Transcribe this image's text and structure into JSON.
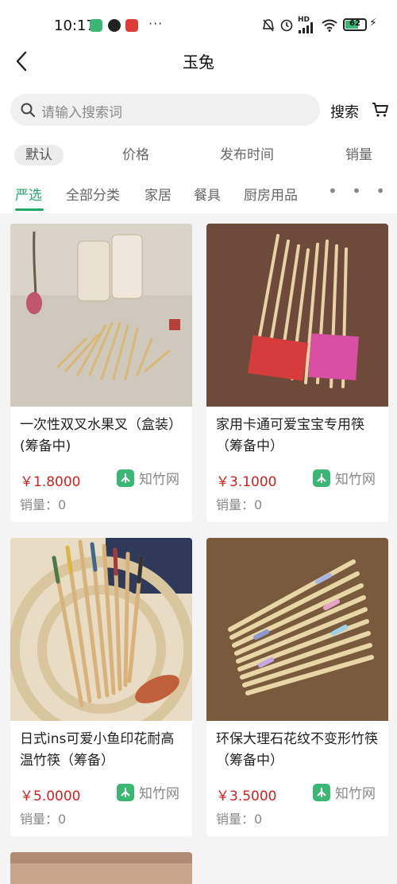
{
  "status_bar": {
    "time": "10:17",
    "battery": "62"
  },
  "header": {
    "title": "玉兔"
  },
  "search": {
    "placeholder": "请输入搜索词",
    "button_label": "搜索"
  },
  "sort_options": [
    "默认",
    "价格",
    "发布时间",
    "销量"
  ],
  "categories": [
    "严选",
    "全部分类",
    "家居",
    "餐具",
    "厨房用品"
  ],
  "more_label": "• • •",
  "products": [
    {
      "name": "一次性双叉水果叉（盒装）(筹备中)",
      "price": "￥1.8000",
      "brand": "知竹网",
      "sales": "销量：0",
      "image": "bamboo-fruit-forks"
    },
    {
      "name": "家用卡通可爱宝宝专用筷（筹备中）",
      "price": "￥3.1000",
      "brand": "知竹网",
      "sales": "销量：0",
      "image": "cartoon-chopsticks"
    },
    {
      "name": "日式ins可爱小鱼印花耐高温竹筷（筹备）",
      "price": "￥5.0000",
      "brand": "知竹网",
      "sales": "销量：0",
      "image": "fish-print-chopsticks"
    },
    {
      "name": "环保大理石花纹不变形竹筷（筹备中）",
      "price": "￥3.5000",
      "brand": "知竹网",
      "sales": "销量：0",
      "image": "marble-chopsticks"
    }
  ],
  "colors": {
    "accent": "#27a86a",
    "price": "#d42020",
    "brand_logo": "#3ab773"
  }
}
